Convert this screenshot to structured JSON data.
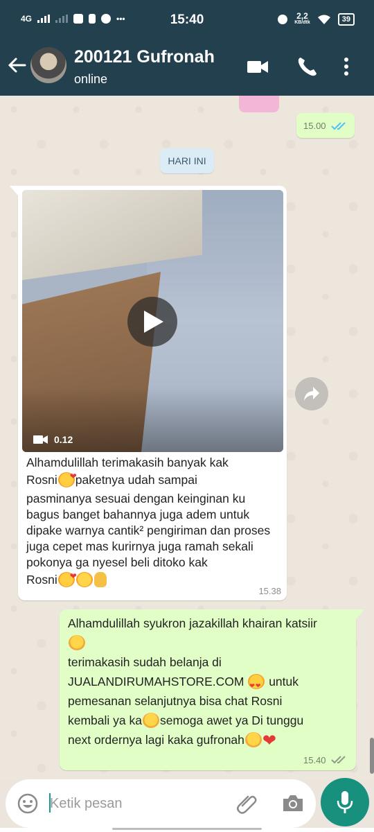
{
  "status_bar": {
    "network": "4G",
    "time": "15:40",
    "speed_value": "2,2",
    "speed_unit": "KB/dtk",
    "battery": "39"
  },
  "header": {
    "contact_name": "200121 Gufronah",
    "status": "online",
    "icons": [
      "back-arrow-icon",
      "video-call-icon",
      "voice-call-icon",
      "overflow-menu-icon"
    ]
  },
  "chat": {
    "prev_outgoing_time": "15.00",
    "date_chip": "HARI INI",
    "incoming": {
      "video_duration": "0.12",
      "caption_lines": [
        "Alhamdulillah terimakasih banyak kak",
        "Rosni",
        "paketnya udah sampai",
        "pasminanya sesuai dengan keinginan ku bagus banget bahannya juga adem untuk dipake warnya cantik² pengiriman dan proses juga cepet mas kurirnya juga ramah sekali pokonya ga nyesel beli ditoko kak",
        "Rosni"
      ],
      "time": "15.38"
    },
    "outgoing": {
      "lines": [
        "Alhamdulillah syukron jazakillah khairan katsiir",
        "terimakasih sudah belanja di",
        "JUALANDIRUMAHSTORE.COM",
        "untuk",
        "pemesanan selanjutnya bisa chat Rosni",
        "kembali ya ka",
        "semoga awet ya Di tunggu",
        "next ordernya lagi kaka gufronah"
      ],
      "time": "15.40"
    },
    "colors": {
      "outgoing_bubble": "#e1fec6",
      "incoming_bubble": "#ffffff",
      "read_ticks": "#4fc3f7",
      "header": "#23404f",
      "mic_button": "#17907e"
    }
  },
  "composer": {
    "placeholder": "Ketik pesan",
    "value": ""
  }
}
